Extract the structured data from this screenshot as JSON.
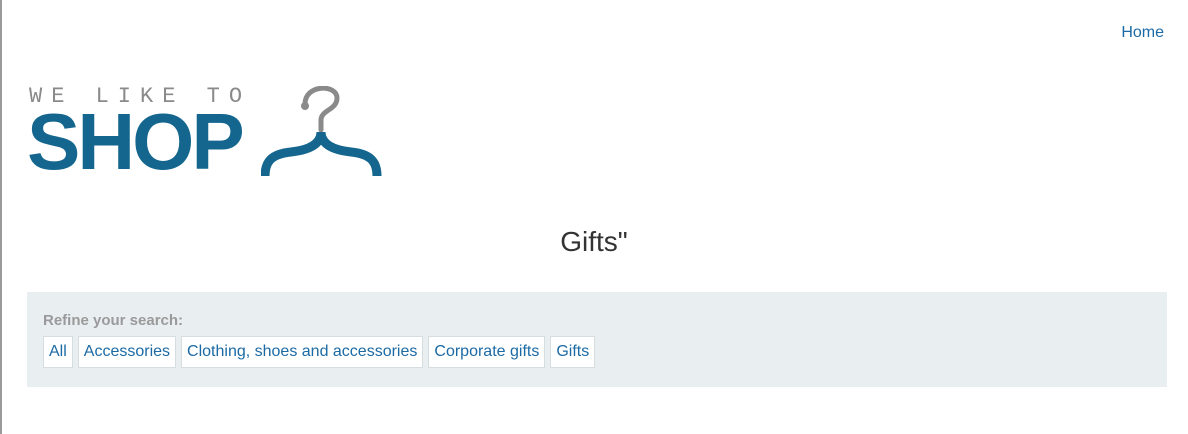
{
  "nav": {
    "home_label": "Home"
  },
  "logo": {
    "tagline": "WE LIKE TO",
    "word": "SHOP",
    "icon": "hanger-icon",
    "colors": {
      "word": "#14668e",
      "tagline": "#8a8a8a",
      "hook": "#8a8a8a",
      "hanger": "#14668e"
    }
  },
  "page": {
    "title": "Gifts\""
  },
  "filter": {
    "label": "Refine your search:",
    "options": [
      {
        "label": "All"
      },
      {
        "label": "Accessories"
      },
      {
        "label": "Clothing, shoes and accessories"
      },
      {
        "label": "Corporate gifts"
      },
      {
        "label": "Gifts"
      }
    ]
  },
  "colors": {
    "link": "#1b6aa5",
    "panel_bg": "#e9eef1",
    "title_text": "#333333"
  }
}
